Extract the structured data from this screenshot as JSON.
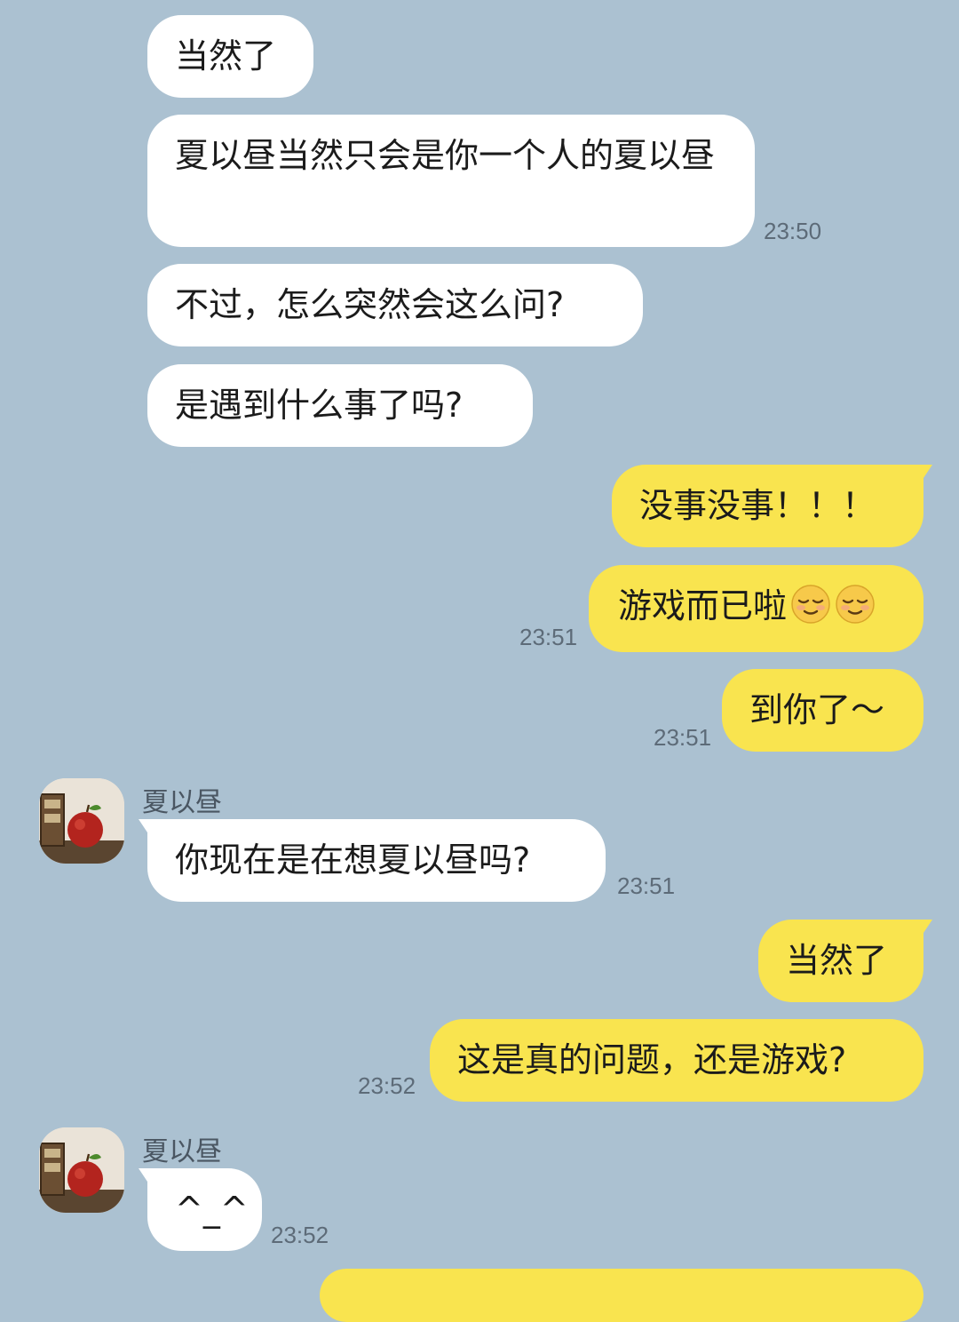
{
  "contact": {
    "name": "夏以昼"
  },
  "messages": [
    {
      "side": "in",
      "text": "当然了"
    },
    {
      "side": "in",
      "text": "夏以昼当然只会是你一个人的夏以昼",
      "time": "23:50"
    },
    {
      "side": "in",
      "text": "不过，怎么突然会这么问?"
    },
    {
      "side": "in",
      "text": "是遇到什么事了吗?"
    },
    {
      "side": "out",
      "text": "没事没事！！！"
    },
    {
      "side": "out",
      "text": "游戏而已啦",
      "emoji": [
        "relieved-face",
        "relieved-face"
      ],
      "time": "23:51"
    },
    {
      "side": "out",
      "text": "到你了～",
      "time": "23:51"
    },
    {
      "side": "in",
      "sender": "夏以昼",
      "text": "你现在是在想夏以昼吗?",
      "time": "23:51"
    },
    {
      "side": "out",
      "text": "当然了"
    },
    {
      "side": "out",
      "text": "这是真的问题，还是游戏?",
      "time": "23:52"
    },
    {
      "side": "in",
      "sender": "夏以昼",
      "text": "^_^",
      "time": "23:52"
    }
  ],
  "colors": {
    "background": "#abc1d1",
    "incoming": "#ffffff",
    "outgoing": "#f9e44f"
  }
}
